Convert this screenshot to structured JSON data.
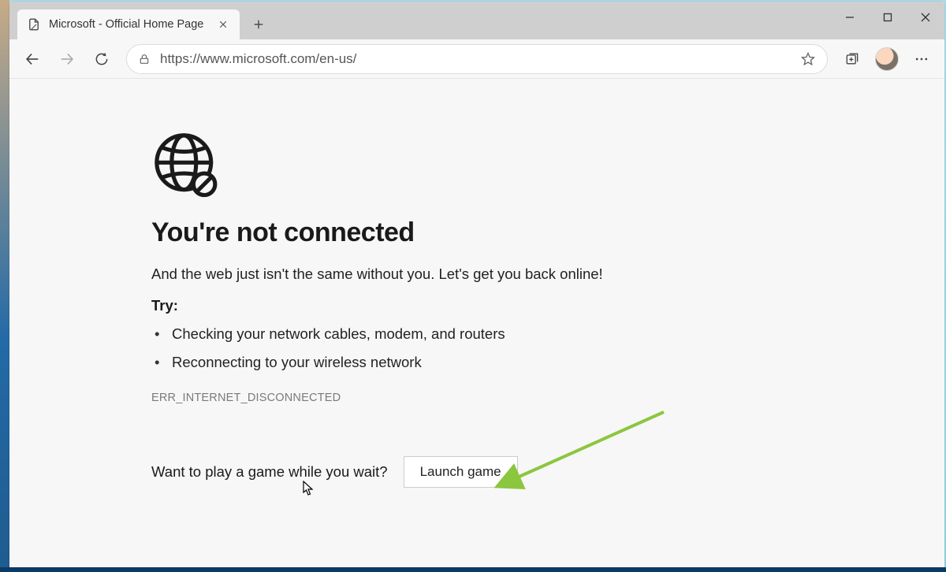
{
  "tab": {
    "title": "Microsoft - Official Home Page"
  },
  "address": {
    "url": "https://www.microsoft.com/en-us/"
  },
  "error": {
    "heading": "You're not connected",
    "subtext": "And the web just isn't the same without you. Let's get you back online!",
    "try_label": "Try:",
    "tips": [
      "Checking your network cables, modem, and routers",
      "Reconnecting to your wireless network"
    ],
    "code": "ERR_INTERNET_DISCONNECTED",
    "game_prompt": "Want to play a game while you wait?",
    "launch_label": "Launch game"
  },
  "annotation": {
    "arrow_color": "#8CC63F"
  }
}
